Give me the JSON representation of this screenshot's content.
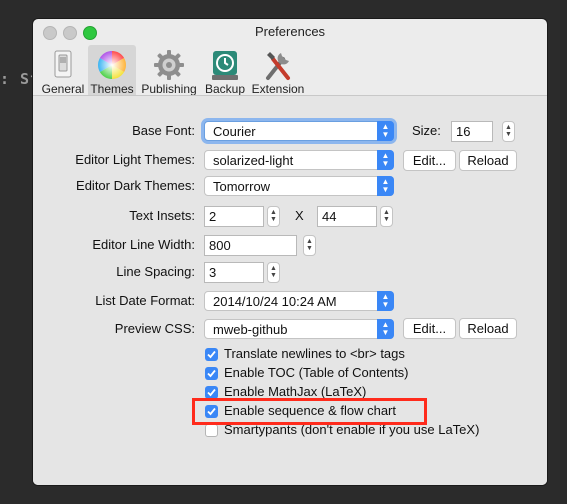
{
  "background_text": ": St",
  "window": {
    "title": "Preferences",
    "toolbar": [
      {
        "label": "General",
        "icon": "general-switch-icon"
      },
      {
        "label": "Themes",
        "icon": "color-wheel-icon"
      },
      {
        "label": "Publishing",
        "icon": "gear-icon"
      },
      {
        "label": "Backup",
        "icon": "time-machine-icon"
      },
      {
        "label": "Extension",
        "icon": "tools-icon"
      }
    ],
    "active_tab": "Themes"
  },
  "form": {
    "base_font": {
      "label": "Base Font:",
      "value": "Courier"
    },
    "size": {
      "label": "Size:",
      "value": "16"
    },
    "light_themes": {
      "label": "Editor Light Themes:",
      "value": "solarized-light"
    },
    "dark_themes": {
      "label": "Editor Dark Themes:",
      "value": "Tomorrow"
    },
    "text_insets": {
      "label": "Text Insets:",
      "x_value": "2",
      "separator": "X",
      "y_value": "44"
    },
    "line_width": {
      "label": "Editor Line Width:",
      "value": "800"
    },
    "line_spacing": {
      "label": "Line Spacing:",
      "value": "3"
    },
    "date_format": {
      "label": "List Date Format:",
      "value": "2014/10/24 10:24 AM"
    },
    "preview_css": {
      "label": "Preview CSS:",
      "value": "mweb-github"
    },
    "edit_label": "Edit...",
    "reload_label": "Reload"
  },
  "checkboxes": [
    {
      "label": "Translate newlines to <br> tags",
      "checked": true
    },
    {
      "label": "Enable TOC (Table of Contents)",
      "checked": true
    },
    {
      "label": "Enable MathJax (LaTeX)",
      "checked": true
    },
    {
      "label": "Enable sequence & flow chart",
      "checked": true
    },
    {
      "label": "Smartypants (don't enable if you use LaTeX)",
      "checked": false
    }
  ],
  "colors": {
    "accent": "#3a87f6",
    "highlight": "#ff2b1c"
  }
}
